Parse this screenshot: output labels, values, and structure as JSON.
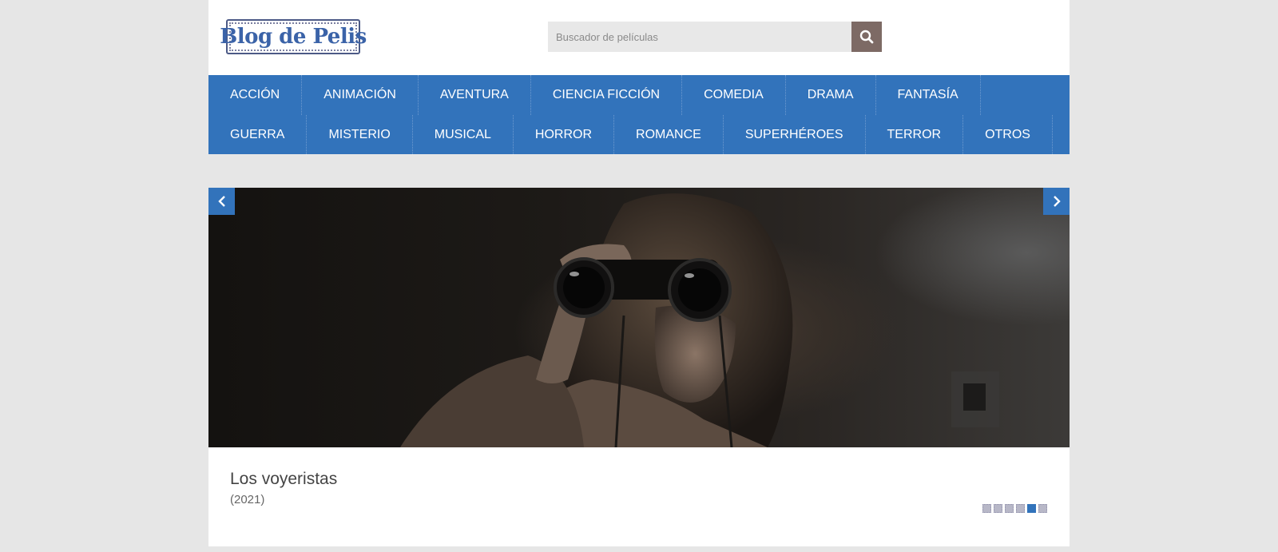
{
  "header": {
    "logo_text": "Blog de Pelis",
    "search": {
      "placeholder": "Buscador de películas",
      "value": "",
      "button_icon": "search-icon"
    }
  },
  "nav": {
    "row1": [
      {
        "label": "ACCIÓN"
      },
      {
        "label": "ANIMACIÓN"
      },
      {
        "label": "AVENTURA"
      },
      {
        "label": "CIENCIA FICCIÓN"
      },
      {
        "label": "COMEDIA"
      },
      {
        "label": "DRAMA"
      },
      {
        "label": "FANTASÍA"
      }
    ],
    "row2": [
      {
        "label": "GUERRA"
      },
      {
        "label": "MISTERIO"
      },
      {
        "label": "MUSICAL"
      },
      {
        "label": "HORROR"
      },
      {
        "label": "ROMANCE"
      },
      {
        "label": "SUPERHÉROES"
      },
      {
        "label": "TERROR"
      },
      {
        "label": "OTROS"
      }
    ]
  },
  "slider": {
    "prev_icon": "chevron-left-icon",
    "next_icon": "chevron-right-icon",
    "image_description_icon": "movie-still-image",
    "caption": {
      "title": "Los voyeristas",
      "year": "(2021)"
    },
    "dots": {
      "count": 6,
      "active_index": 4
    }
  },
  "colors": {
    "accent": "#3273bb",
    "search_button": "#7d6a65",
    "page_bg": "#e6e6e6"
  }
}
